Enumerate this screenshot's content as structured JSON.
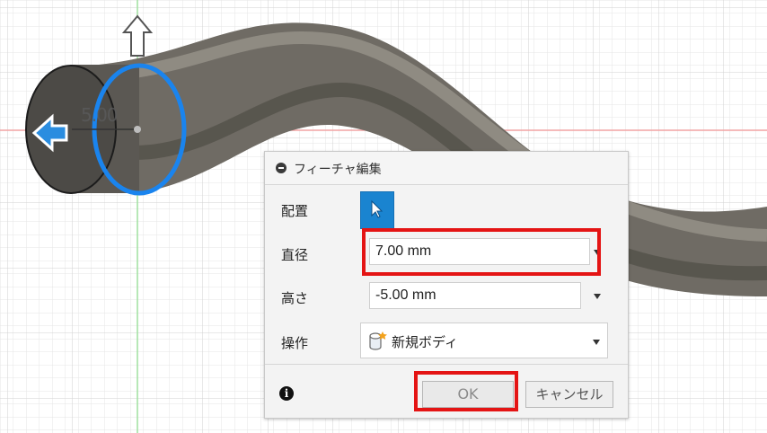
{
  "viewport": {
    "dimension_value": "5.00"
  },
  "dialog": {
    "title": "フィーチャ編集",
    "rows": {
      "placement_label": "配置",
      "diameter_label": "直径",
      "diameter_value": "7.00 mm",
      "height_label": "高さ",
      "height_value": "-5.00 mm",
      "operation_label": "操作",
      "operation_value": "新規ボディ"
    },
    "footer": {
      "ok_label": "OK",
      "cancel_label": "キャンセル"
    }
  },
  "colors": {
    "accent_blue": "#1a84d0",
    "highlight_red": "#e41414",
    "body_gray": "#6f6b64"
  }
}
